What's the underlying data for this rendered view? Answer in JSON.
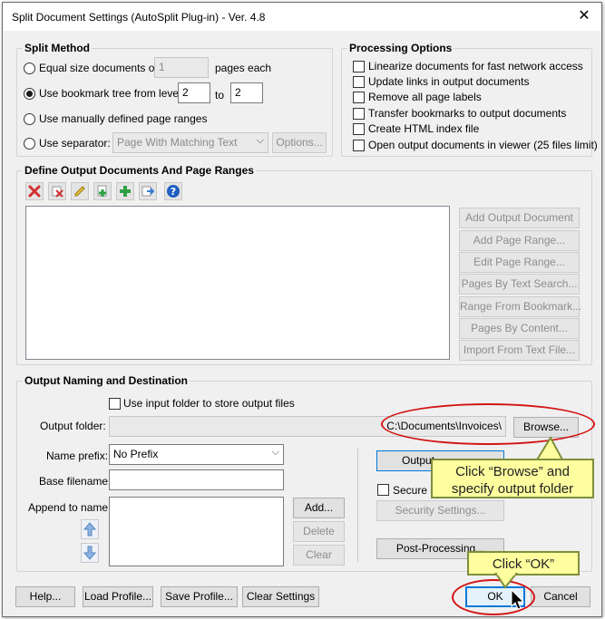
{
  "window": {
    "title": "Split Document Settings (AutoSplit Plug-in) - Ver. 4.8",
    "close_glyph": "✕"
  },
  "split_method": {
    "title": "Split Method",
    "equal_size_label": "Equal size documents of",
    "equal_size_value": "1",
    "pages_each_label": "pages each",
    "bookmark_label": "Use bookmark tree from level",
    "bookmark_from": "2",
    "to_label": "to",
    "bookmark_to": "2",
    "manual_ranges_label": "Use manually defined page ranges",
    "separator_label": "Use separator:",
    "separator_value": "Page With Matching Text",
    "options_button": "Options..."
  },
  "processing_options": {
    "title": "Processing Options",
    "items": [
      "Linearize documents for fast network access",
      "Update links in output documents",
      "Remove all page labels",
      "Transfer bookmarks to output documents",
      "Create HTML index file",
      "Open output documents in viewer (25 files limit)"
    ]
  },
  "define_output": {
    "title": "Define Output Documents And Page Ranges",
    "buttons": [
      "Add Output Document",
      "Add Page Range...",
      "Edit Page Range...",
      "Pages By Text Search...",
      "Range From Bookmark...",
      "Pages By Content...",
      "Import From Text File..."
    ]
  },
  "output_naming": {
    "title": "Output Naming and Destination",
    "use_input_folder_label": "Use input folder to store output files",
    "output_folder_label": "Output folder:",
    "output_folder_value": "C:\\Documents\\Invoices\\",
    "browse_button": "Browse...",
    "name_prefix_label": "Name prefix:",
    "name_prefix_value": "No Prefix",
    "base_filename_label": "Base filename:",
    "append_label": "Append to name:",
    "add_button": "Add...",
    "delete_button": "Delete",
    "clear_button": "Clear",
    "output_button": "Output",
    "secure_label": "Secure ou",
    "security_settings_button": "Security Settings...",
    "post_processing_button": "Post-Processing..."
  },
  "footer": {
    "help": "Help...",
    "load_profile": "Load Profile...",
    "save_profile": "Save Profile...",
    "clear_settings": "Clear Settings",
    "ok": "OK",
    "cancel": "Cancel"
  },
  "annotations": {
    "browse_callout": "Click “Browse” and specify output folder",
    "ok_callout": "Click “OK”"
  },
  "colors": {
    "highlight_ring": "#d21414",
    "callout_bg": "#ffffa0",
    "default_button_border": "#0078d7"
  }
}
